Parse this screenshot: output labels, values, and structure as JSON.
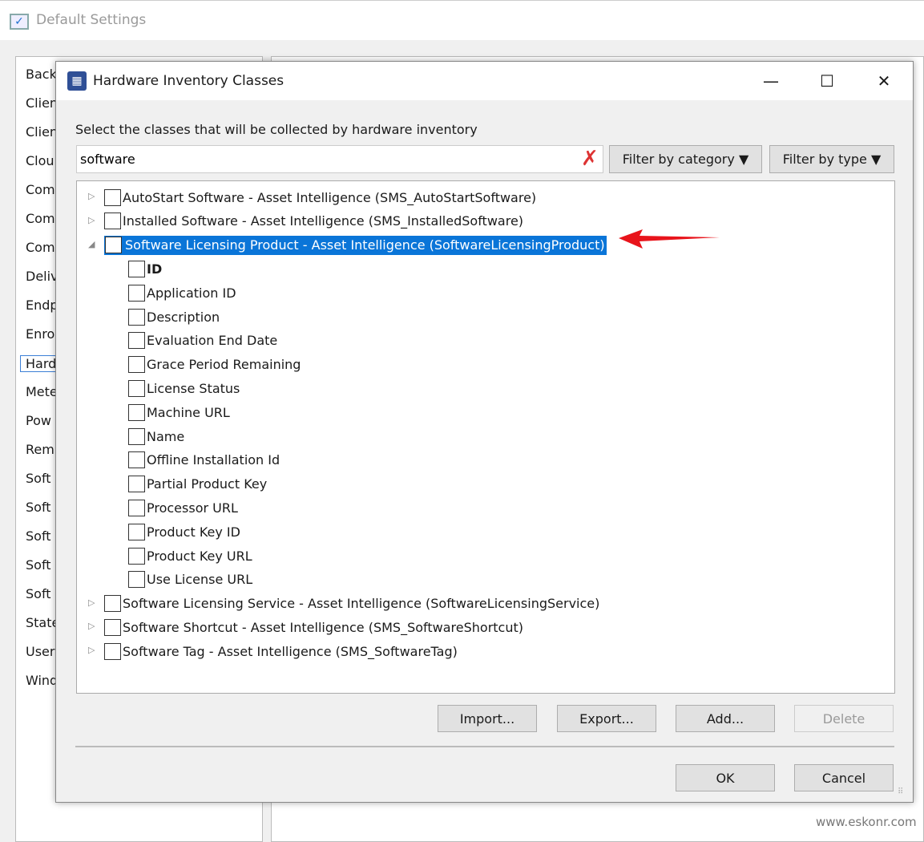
{
  "outer": {
    "title": "Default Settings",
    "sidebar": [
      "Back",
      "Clien",
      "Clien",
      "Clou",
      "Com",
      "Com",
      "Com",
      "Deliv",
      "Endp",
      "Enro",
      "Hard",
      "Mete",
      "Pow",
      "Rem",
      "Soft",
      "Soft",
      "Soft",
      "Soft",
      "Soft",
      "State",
      "User",
      "Wind"
    ],
    "selected_index": 10
  },
  "dialog": {
    "title": "Hardware Inventory Classes",
    "instruction": "Select the classes that will be collected by hardware inventory",
    "search": {
      "value": "software"
    },
    "filter_category": "Filter by category",
    "filter_type": "Filter by type",
    "dropdown_glyph": "▼",
    "tree": [
      {
        "label": "AutoStart Software - Asset Intelligence (SMS_AutoStartSoftware)",
        "expanded": false
      },
      {
        "label": "Installed Software - Asset Intelligence (SMS_InstalledSoftware)",
        "expanded": false
      },
      {
        "label": "Software Licensing Product - Asset Intelligence (SoftwareLicensingProduct)",
        "expanded": true,
        "selected": true,
        "children": [
          "ID",
          "Application ID",
          "Description",
          "Evaluation End Date",
          "Grace Period Remaining",
          "License Status",
          "Machine URL",
          "Name",
          "Offline Installation Id",
          "Partial Product Key",
          "Processor URL",
          "Product Key ID",
          "Product Key URL",
          "Use License URL"
        ]
      },
      {
        "label": "Software Licensing Service - Asset Intelligence (SoftwareLicensingService)",
        "expanded": false
      },
      {
        "label": "Software Shortcut - Asset Intelligence (SMS_SoftwareShortcut)",
        "expanded": false
      },
      {
        "label": "Software Tag - Asset Intelligence (SMS_SoftwareTag)",
        "expanded": false
      }
    ],
    "buttons": {
      "import": "Import...",
      "export": "Export...",
      "add": "Add...",
      "delete": "Delete",
      "ok": "OK",
      "cancel": "Cancel"
    }
  },
  "watermark": "www.eskonr.com",
  "colors": {
    "selection": "#0a75d8",
    "arrow": "#e8141b",
    "clear_icon": "#d33333"
  }
}
